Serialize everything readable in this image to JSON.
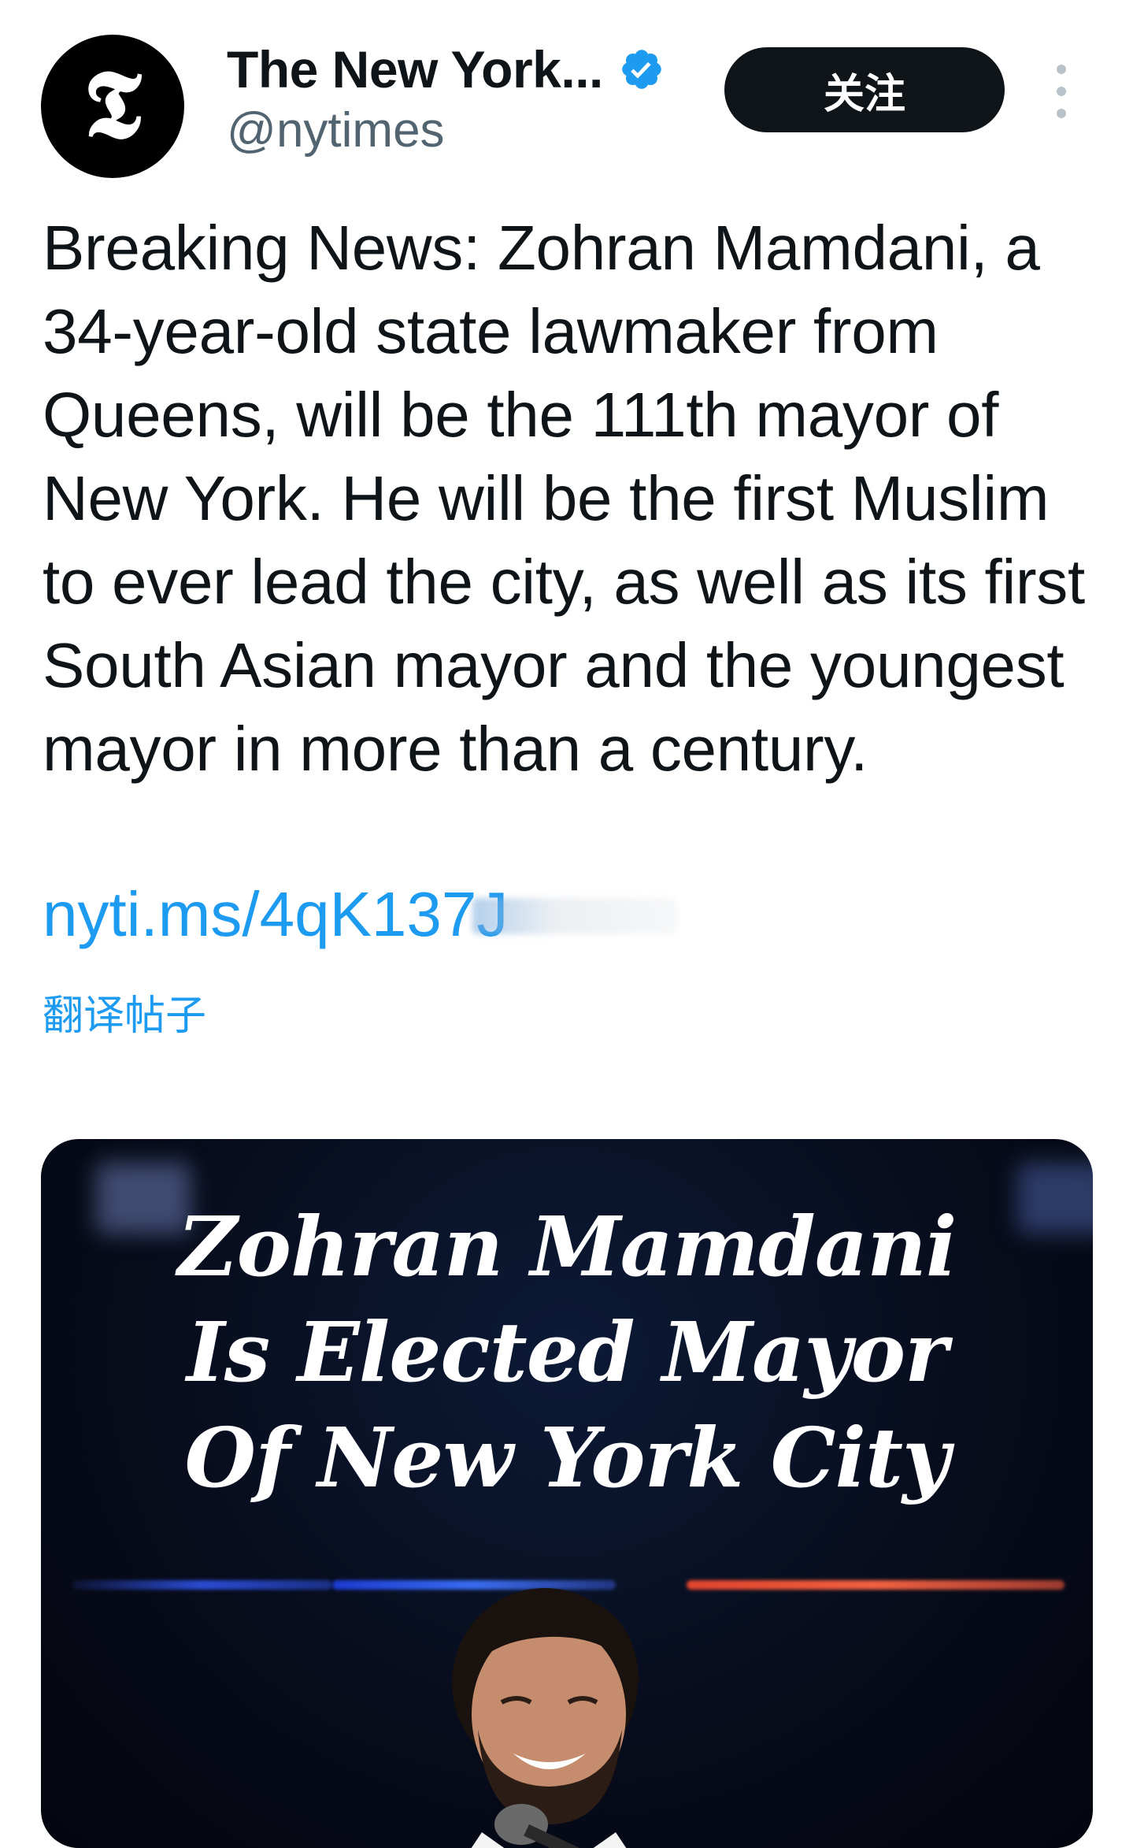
{
  "account": {
    "avatar_glyph": "𝕿",
    "display_name": "The New York...",
    "handle": "@nytimes",
    "verified_icon": "verified-badge-icon",
    "verified_color": "#1d9bf0"
  },
  "actions": {
    "follow_label": "关注",
    "more_icon": "more-vertical-icon"
  },
  "tweet": {
    "text": "Breaking News: Zohran Mamdani, a 34-year-old state lawmaker from Queens, will be the 111th mayor of New York. He will be the first Muslim to ever lead the city, as well as its first South Asian mayor and the youngest mayor in more than a century.",
    "link": "nyti.ms/4qK137J",
    "translate_label": "翻译帖子"
  },
  "media": {
    "headline_lines": [
      "Zohran Mamdani",
      "Is Elected Mayor",
      "Of New York City"
    ]
  },
  "colors": {
    "text": "#0f1419",
    "secondary": "#536471",
    "link": "#1d9bf0",
    "button_bg": "#0f1419"
  }
}
